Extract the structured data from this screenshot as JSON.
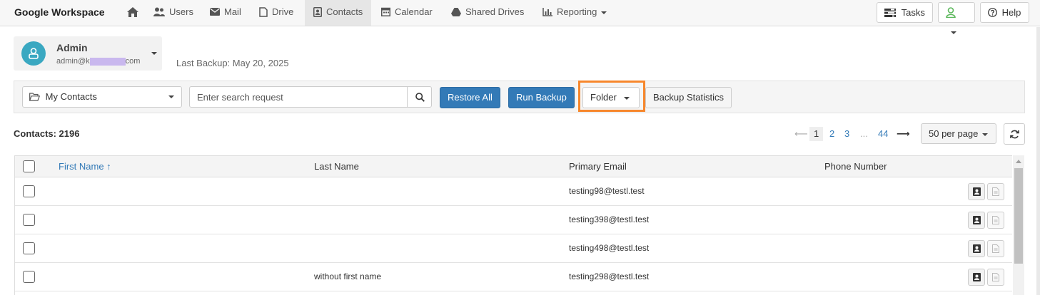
{
  "app": {
    "brand": "Google Workspace"
  },
  "nav": {
    "items": [
      {
        "id": "home",
        "label": ""
      },
      {
        "id": "users",
        "label": "Users"
      },
      {
        "id": "mail",
        "label": "Mail"
      },
      {
        "id": "drive",
        "label": "Drive"
      },
      {
        "id": "contacts",
        "label": "Contacts",
        "active": true
      },
      {
        "id": "calendar",
        "label": "Calendar"
      },
      {
        "id": "shared_drives",
        "label": "Shared Drives"
      },
      {
        "id": "reporting",
        "label": "Reporting"
      }
    ],
    "tasks_label": "Tasks",
    "help_label": "Help"
  },
  "account": {
    "name": "Admin",
    "email_prefix": "admin@k",
    "email_suffix": "com"
  },
  "backup": {
    "last_backup": "Last Backup: May 20, 2025"
  },
  "toolbar": {
    "folder_select": "My Contacts",
    "search_placeholder": "Enter search request",
    "restore_all": "Restore All",
    "run_backup": "Run Backup",
    "folder": "Folder",
    "backup_statistics": "Backup Statistics"
  },
  "summary": {
    "contacts_count": "Contacts: 2196"
  },
  "pagination": {
    "prev": "⟵",
    "pages": [
      "1",
      "2",
      "3"
    ],
    "ellipsis": "...",
    "last": "44",
    "next": "⟶",
    "current": "1",
    "per_page": "50 per page"
  },
  "table": {
    "headers": {
      "first_name": "First Name ↑",
      "last_name": "Last Name",
      "primary_email": "Primary Email",
      "phone_number": "Phone Number"
    },
    "rows": [
      {
        "first_name": "",
        "last_name": "",
        "email": "testing98@testl.test",
        "phone": ""
      },
      {
        "first_name": "",
        "last_name": "",
        "email": "testing398@testl.test",
        "phone": ""
      },
      {
        "first_name": "",
        "last_name": "",
        "email": "testing498@testl.test",
        "phone": ""
      },
      {
        "first_name": "",
        "last_name": "without first name",
        "email": "testing298@testl.test",
        "phone": ""
      }
    ]
  },
  "colors": {
    "primary": "#337ab7",
    "highlight": "#f7872c",
    "avatar": "#3aa8c1",
    "account_status": "#5cb85c"
  },
  "icons": {
    "home": "home-icon",
    "users": "users-icon",
    "mail": "envelope-icon",
    "drive": "file-icon",
    "contacts": "contact-card-icon",
    "calendar": "calendar-icon",
    "shared_drives": "drive-triangle-icon",
    "reporting": "bar-chart-icon",
    "tasks": "tasks-icon",
    "account": "user-icon",
    "help": "question-circle-icon",
    "folder": "folder-open-icon",
    "search": "search-icon",
    "refresh": "refresh-icon",
    "row_view": "contact-card-icon",
    "row_export": "document-icon"
  }
}
